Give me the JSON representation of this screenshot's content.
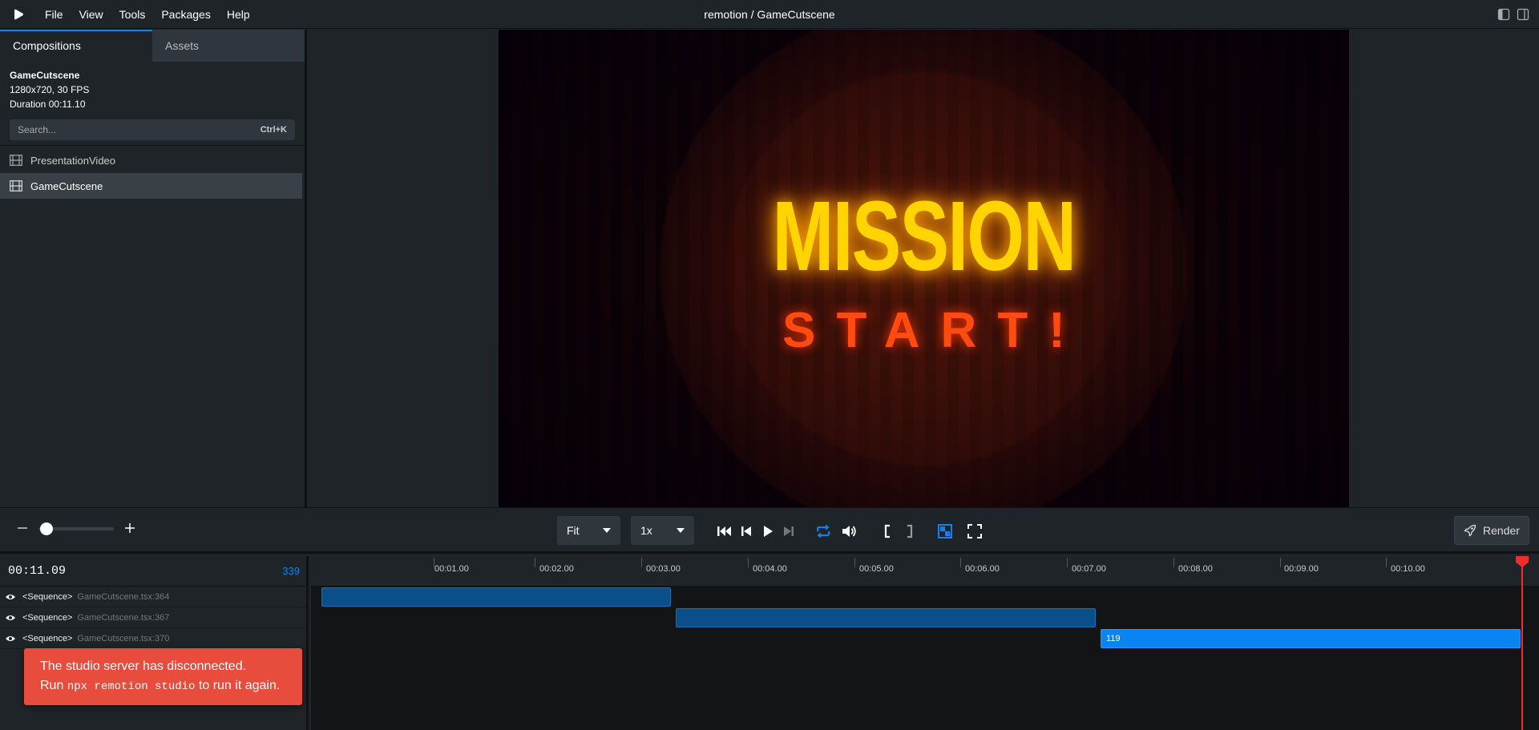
{
  "menu": {
    "items": [
      "File",
      "View",
      "Tools",
      "Packages",
      "Help"
    ],
    "title": "remotion / GameCutscene"
  },
  "sidebar": {
    "tabs": [
      {
        "label": "Compositions",
        "active": true
      },
      {
        "label": "Assets",
        "active": false
      }
    ],
    "composition": {
      "name": "GameCutscene",
      "resolution": "1280x720, 30 FPS",
      "duration": "Duration 00:11.10"
    },
    "search": {
      "placeholder": "Search...",
      "shortcut": "Ctrl+K"
    },
    "items": [
      {
        "label": "PresentationVideo",
        "selected": false,
        "icon": "film-icon"
      },
      {
        "label": "GameCutscene",
        "selected": true,
        "icon": "film-icon"
      }
    ]
  },
  "preview": {
    "headline": "MISSION",
    "subline": "START!"
  },
  "controls": {
    "size_select": "Fit",
    "speed_select": "1x",
    "render_label": "Render"
  },
  "timeline": {
    "current_time": "00:11.09",
    "current_frame": "339",
    "ticks": [
      "00:01.00",
      "00:02.00",
      "00:03.00",
      "00:04.00",
      "00:05.00",
      "00:06.00",
      "00:07.00",
      "00:08.00",
      "00:09.00",
      "00:10.00"
    ],
    "tracks": [
      {
        "name": "<Sequence>",
        "source": "GameCutscene.tsx:364",
        "bar_label": ""
      },
      {
        "name": "<Sequence>",
        "source": "GameCutscene.tsx:367",
        "bar_label": ""
      },
      {
        "name": "<Sequence>",
        "source": "GameCutscene.tsx:370",
        "bar_label": "119"
      }
    ]
  },
  "toast": {
    "line1": "The studio server has disconnected.",
    "line2_pre": "Run",
    "line2_code": "npx remotion studio",
    "line2_post": "to run it again."
  },
  "colors": {
    "accent": "#0b84f3",
    "toast": "#e74c3c",
    "playhead": "#f02c2c",
    "headline": "#ffd400",
    "subline": "#ff4a10"
  }
}
